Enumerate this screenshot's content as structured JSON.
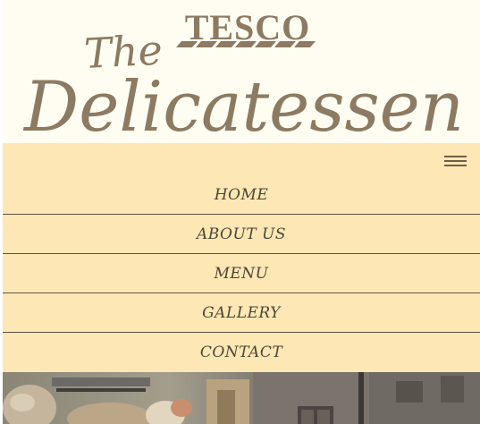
{
  "header": {
    "brand": "TESCO",
    "tagline_line1": "The",
    "tagline_line2": "Delicatessen"
  },
  "nav": {
    "toggle_icon": "hamburger-menu-icon",
    "items": [
      {
        "label": "HOME"
      },
      {
        "label": "ABOUT US"
      },
      {
        "label": "MENU"
      },
      {
        "label": "GALLERY"
      },
      {
        "label": "CONTACT"
      }
    ]
  },
  "colors": {
    "header_bg": "#fffdf1",
    "nav_bg": "#fde8b5",
    "logo": "#8c7a62",
    "text": "#4e4434"
  }
}
